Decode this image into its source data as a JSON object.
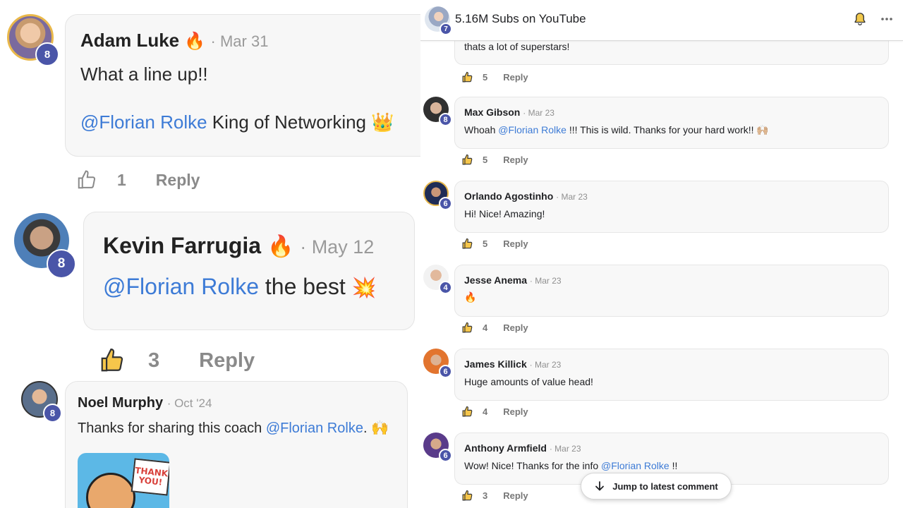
{
  "left_panel": {
    "comments": [
      {
        "author": "Adam Luke",
        "author_emoji": "🔥",
        "date": "· Mar 31",
        "level": "8",
        "line1": "What a line up!!",
        "mention": "@Florian Rolke",
        "line2": "King of Networking",
        "line2_emoji": "👑",
        "likes": "1",
        "reply_label": "Reply"
      },
      {
        "author": "Kevin Farrugia",
        "author_emoji": "🔥",
        "date": "· May 12",
        "level": "8",
        "mention": "@Florian Rolke",
        "text": "the best",
        "text_emoji": "💥",
        "likes": "3",
        "reply_label": "Reply"
      },
      {
        "author": "Noel Murphy",
        "date": "· Oct '24",
        "level": "8",
        "text": "Thanks for sharing this coach",
        "mention": "@Florian Rolke",
        "text_after": ".",
        "text_emoji": "🙌",
        "gif_text": "THANK YOU!"
      }
    ]
  },
  "right_panel": {
    "header": {
      "title": "5.16M Subs on YouTube",
      "level": "7",
      "bell_icon": "bell-icon",
      "more_icon": "more-horizontal-icon"
    },
    "partial_comment": {
      "text": "thats a lot of superstars!",
      "likes": "5",
      "reply_label": "Reply"
    },
    "comments": [
      {
        "author": "Max Gibson",
        "date": "· Mar 23",
        "level": "8",
        "text_before": "Whoah ",
        "mention": "@Florian Rolke",
        "text_after": " !!! This is wild. Thanks for your hard work!! 🙌🏼",
        "likes": "5",
        "reply_label": "Reply"
      },
      {
        "author": "Orlando Agostinho",
        "date": "· Mar 23",
        "level": "6",
        "text_before": "Hi! Nice! Amazing!",
        "mention": "",
        "text_after": "",
        "likes": "5",
        "reply_label": "Reply"
      },
      {
        "author": "Jesse Anema",
        "date": "· Mar 23",
        "level": "4",
        "text_before": "🔥",
        "mention": "",
        "text_after": "",
        "likes": "4",
        "reply_label": "Reply"
      },
      {
        "author": "James Killick",
        "date": "· Mar 23",
        "level": "6",
        "text_before": "Huge amounts of value head!",
        "mention": "",
        "text_after": "",
        "likes": "4",
        "reply_label": "Reply"
      },
      {
        "author": "Anthony Armfield",
        "date": "· Mar 23",
        "level": "6",
        "text_before": "Wow! Nice! Thanks for the info ",
        "mention": "@Florian Rolke",
        "text_after": " !!",
        "likes": "3",
        "reply_label": "Reply"
      }
    ],
    "jump_button": "Jump to latest comment"
  },
  "colors": {
    "mention": "#3d7bd6",
    "badge": "#4a55a8",
    "bubble": "#f8f8f8"
  }
}
